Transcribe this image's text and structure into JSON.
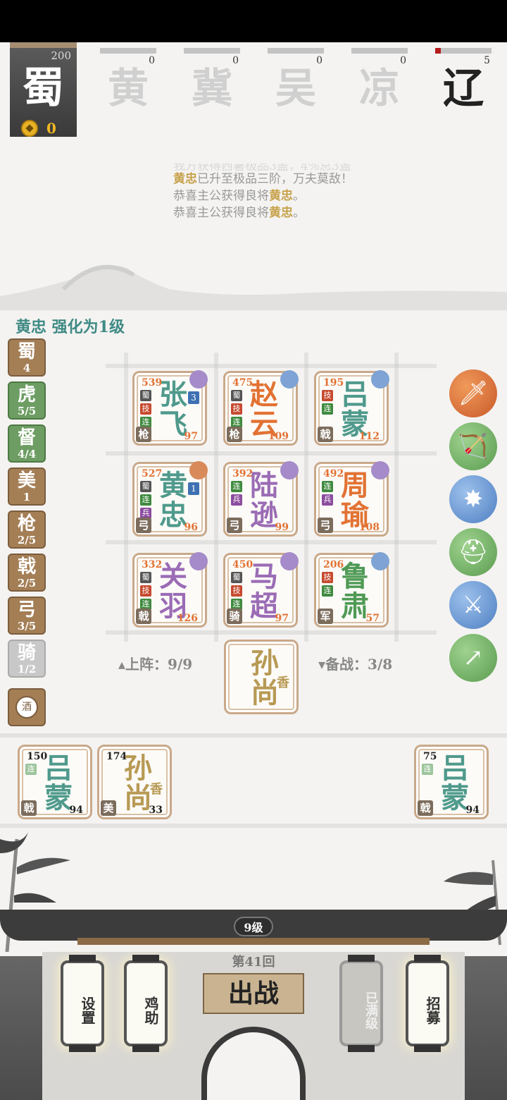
{
  "factions": {
    "active": {
      "name": "蜀",
      "score": "200",
      "coins": "0"
    },
    "others": [
      {
        "name": "黄",
        "score": "0",
        "progress": 0.0
      },
      {
        "name": "冀",
        "score": "0",
        "progress": 0.0
      },
      {
        "name": "吴",
        "score": "0",
        "progress": 0.0
      },
      {
        "name": "凉",
        "score": "0",
        "progress": 0.0
      },
      {
        "name": "辽",
        "score": "5",
        "progress": 0.1
      }
    ]
  },
  "log": {
    "line0": "我方获得西暑极品3盖，4%总3盖",
    "line1_hero": "黄忠",
    "line1_text": "已升至极品三阶，万夫莫敌！",
    "line2_text": "恭喜主公获得良将",
    "line2_hero": "黄忠",
    "line2_end": "。",
    "line3_text": "恭喜主公获得良将",
    "line3_hero": "黄忠",
    "line3_end": "。"
  },
  "notice": "黄忠 强化为1级",
  "filters": [
    {
      "label": "蜀",
      "count": "4"
    },
    {
      "label": "虎",
      "count": "5/5"
    },
    {
      "label": "督",
      "count": "4/4"
    },
    {
      "label": "美",
      "count": "1"
    },
    {
      "label": "枪",
      "count": "2/5"
    },
    {
      "label": "戟",
      "count": "2/5"
    },
    {
      "label": "弓",
      "count": "3/5"
    },
    {
      "label": "骑",
      "count": "1/2"
    }
  ],
  "wine_label": "酒",
  "cards": [
    {
      "lvl": "539",
      "name1": "张",
      "name2": "飞",
      "type": "枪",
      "power": "97",
      "star": "3",
      "tags": [
        "蜀",
        "技",
        "连"
      ]
    },
    {
      "lvl": "475",
      "name1": "赵",
      "name2": "云",
      "type": "枪",
      "power": "109",
      "tags": [
        "蜀",
        "技",
        "连"
      ]
    },
    {
      "lvl": "195",
      "name1": "吕",
      "name2": "蒙",
      "type": "戟",
      "power": "112",
      "tags": [
        "技",
        "连2"
      ]
    },
    {
      "lvl": "527",
      "name1": "黄",
      "name2": "忠",
      "type": "弓",
      "power": "96",
      "star": "1",
      "tags": [
        "蜀",
        "连",
        "兵"
      ]
    },
    {
      "lvl": "392",
      "name1": "陆",
      "name2": "逊",
      "type": "弓",
      "power": "99",
      "tags": [
        "连2",
        "兵"
      ]
    },
    {
      "lvl": "492",
      "name1": "周",
      "name2": "瑜",
      "type": "弓",
      "power": "108",
      "tags": [
        "连",
        "兵"
      ]
    },
    {
      "lvl": "332",
      "name1": "关",
      "name2": "羽",
      "type": "戟",
      "power": "126",
      "tags": [
        "蜀",
        "技",
        "连"
      ]
    },
    {
      "lvl": "450",
      "name1": "马",
      "name2": "超",
      "type": "骑",
      "power": "97",
      "tags": [
        "蜀",
        "技",
        "连"
      ]
    },
    {
      "lvl": "206",
      "name1": "鲁",
      "name2": "肃",
      "type": "军",
      "power": "57",
      "tags": [
        "技",
        "连"
      ]
    }
  ],
  "onfield": "▴上阵：9/9",
  "reserve": "▾备战：3/8",
  "center_card": {
    "name1": "孙",
    "name2": "尚",
    "sub": "香"
  },
  "bench": [
    {
      "lvl": "150",
      "name1": "吕",
      "name2": "蒙",
      "type": "戟",
      "power": "94",
      "tag": "连"
    },
    {
      "lvl": "174",
      "name1": "孙",
      "name2": "尚",
      "sub": "香",
      "type": "美",
      "power": "33"
    },
    {
      "lvl": "75",
      "name1": "吕",
      "name2": "蒙",
      "type": "戟",
      "power": "94",
      "tag": "连"
    }
  ],
  "skills": [
    "dagger-icon",
    "bow-icon",
    "burst-icon",
    "helmet-icon",
    "blade-icon",
    "spear-icon"
  ],
  "bottom": {
    "level": "9级",
    "round": "第41回",
    "battle": "出战",
    "lanterns": [
      {
        "label": "设置"
      },
      {
        "label": "鸡助"
      },
      {
        "label": "已满级"
      },
      {
        "label": "招募"
      }
    ]
  }
}
